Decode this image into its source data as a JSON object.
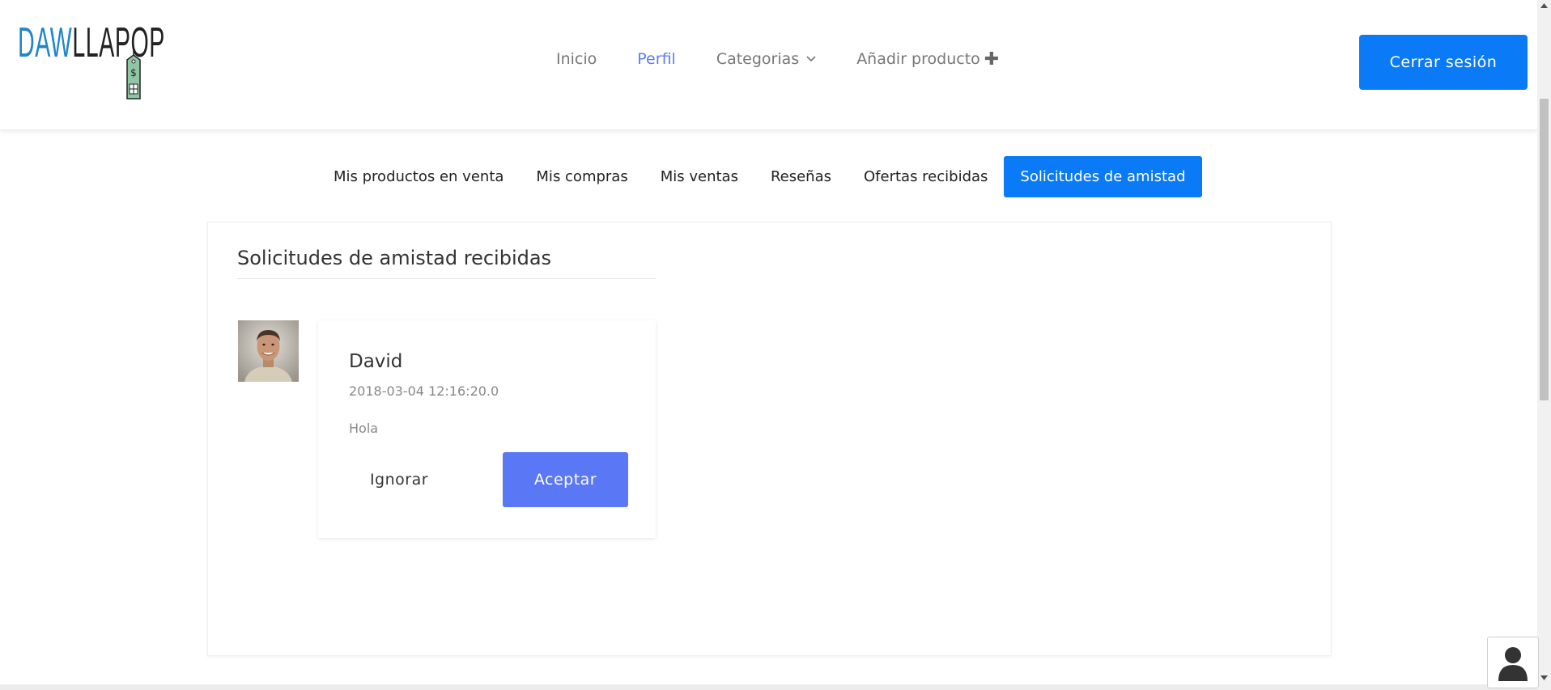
{
  "header": {
    "logo": {
      "text_part1": "DAW",
      "text_part2": "LLAPOP",
      "tag_icon": "price-tag-icon"
    },
    "nav": [
      {
        "label": "Inicio",
        "active": false
      },
      {
        "label": "Perfil",
        "active": true
      },
      {
        "label": "Categorias",
        "active": false,
        "icon": "chevron-down-icon"
      },
      {
        "label": "Añadir producto",
        "active": false,
        "icon": "plus-icon"
      }
    ],
    "logout_label": "Cerrar sesión"
  },
  "tabs": [
    {
      "label": "Mis productos en venta",
      "active": false
    },
    {
      "label": "Mis compras",
      "active": false
    },
    {
      "label": "Mis ventas",
      "active": false
    },
    {
      "label": "Reseñas",
      "active": false
    },
    {
      "label": "Ofertas recibidas",
      "active": false
    },
    {
      "label": "Solicitudes de amistad",
      "active": true
    }
  ],
  "main": {
    "section_title": "Solicitudes de amistad recibidas",
    "requests": [
      {
        "name": "David",
        "date": "2018-03-04 12:16:20.0",
        "message": "Hola",
        "ignore_label": "Ignorar",
        "accept_label": "Aceptar"
      }
    ]
  },
  "widgets": {
    "chat_icon": "user-icon"
  },
  "colors": {
    "primary": "#0a7af6",
    "accent": "#5a77f5",
    "nav_active": "#5b7cf6",
    "logo_blue": "#1f87c8"
  }
}
